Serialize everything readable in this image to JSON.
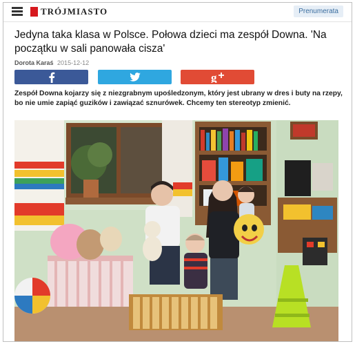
{
  "header": {
    "logo_text": "TRÓJMIASTO",
    "subscribe_label": "Prenumerata"
  },
  "article": {
    "title": "Jedyna taka klasa w Polsce. Połowa dzieci ma zespół Downa. 'Na początku w sali panowała cisza'",
    "author": "Dorota Karaś",
    "date": "2015-12-12",
    "lead": "Zespół Downa kojarzy się z niezgrabnym upośledzonym, który jest ubrany w dres i buty na rzepy, bo nie umie zapiąć guzików i zawiązać sznurówek. Chcemy ten stereotyp zmienić."
  },
  "share": {
    "facebook": {
      "icon": "facebook-icon",
      "color": "#3b5998"
    },
    "twitter": {
      "icon": "twitter-icon",
      "color": "#2fa7e0"
    },
    "googleplus": {
      "icon": "google-plus-icon",
      "color": "#e14b35"
    }
  },
  "colors": {
    "brand": "#d7191e",
    "subscribe_bg": "#e6eef6",
    "subscribe_text": "#3a6d9f"
  }
}
